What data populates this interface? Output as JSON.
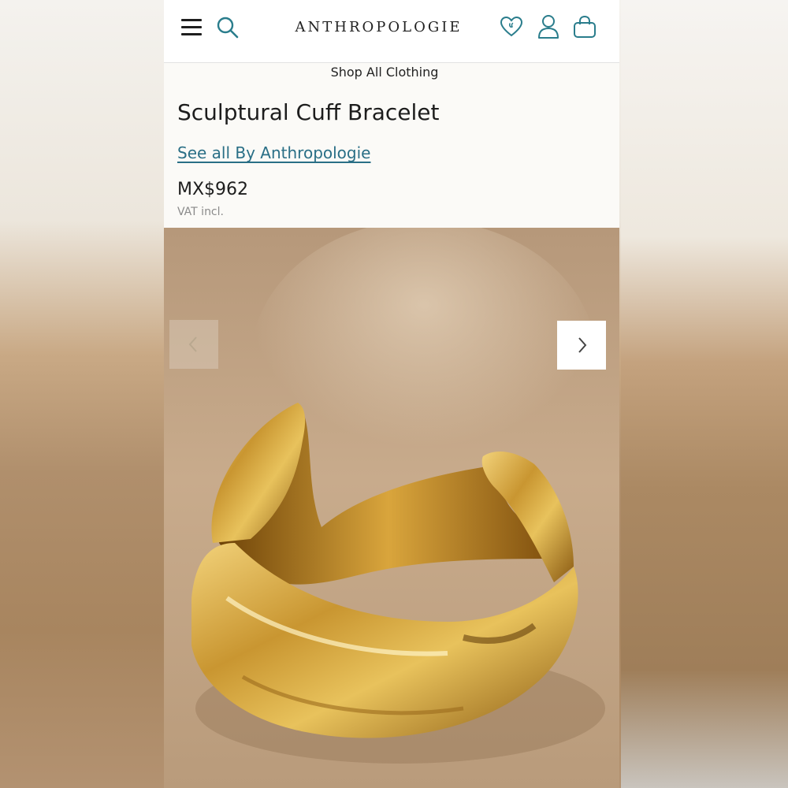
{
  "header": {
    "logo_text": "ANTHROPOLOGIE",
    "icons": [
      "menu-icon",
      "search-icon",
      "heart-icon",
      "user-icon",
      "shopping-bag-icon"
    ],
    "accent_color": "#2a7d8c"
  },
  "breadcrumb": {
    "shop_all": "Shop All Clothing"
  },
  "product": {
    "title": "Sculptural Cuff Bracelet",
    "brand_link": "See all By Anthropologie",
    "price": "MX$962",
    "vat_note": "VAT incl."
  },
  "gallery": {
    "image_description_icon": "gold-cuff-bracelet-photo",
    "prev_icon": "chevron-left-icon",
    "next_icon": "chevron-right-icon"
  },
  "colors": {
    "link": "#2a6f86",
    "text": "#1d1d1d",
    "muted": "#8a8a8a"
  }
}
